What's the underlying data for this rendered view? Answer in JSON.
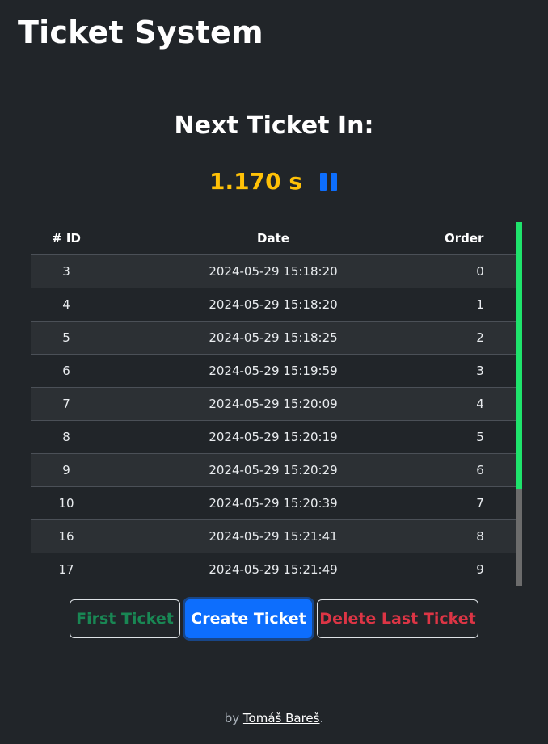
{
  "app": {
    "title": "Ticket System"
  },
  "next": {
    "heading": "Next Ticket In:",
    "timer": "1.170 s",
    "pause_icon": "pause-icon"
  },
  "table": {
    "columns": [
      "# ID",
      "Date",
      "Order"
    ],
    "rows": [
      {
        "id": "3",
        "date": "2024-05-29 15:18:20",
        "order": "0"
      },
      {
        "id": "4",
        "date": "2024-05-29 15:18:20",
        "order": "1"
      },
      {
        "id": "5",
        "date": "2024-05-29 15:18:25",
        "order": "2"
      },
      {
        "id": "6",
        "date": "2024-05-29 15:19:59",
        "order": "3"
      },
      {
        "id": "7",
        "date": "2024-05-29 15:20:09",
        "order": "4"
      },
      {
        "id": "8",
        "date": "2024-05-29 15:20:19",
        "order": "5"
      },
      {
        "id": "9",
        "date": "2024-05-29 15:20:29",
        "order": "6"
      },
      {
        "id": "10",
        "date": "2024-05-29 15:20:39",
        "order": "7"
      },
      {
        "id": "16",
        "date": "2024-05-29 15:21:41",
        "order": "8"
      },
      {
        "id": "17",
        "date": "2024-05-29 15:21:49",
        "order": "9"
      }
    ]
  },
  "actions": {
    "first_label": "First Ticket",
    "create_label": "Create Ticket",
    "delete_label": "Delete Last Ticket"
  },
  "footer": {
    "prefix": "by",
    "author": "Tomáš Bareš",
    "suffix": "."
  },
  "colors": {
    "background": "#212529",
    "timer": "#ffc107",
    "primary": "#0d6efd",
    "success": "#198754",
    "danger": "#dc3545",
    "scroll_thumb": "#1fe36c"
  }
}
